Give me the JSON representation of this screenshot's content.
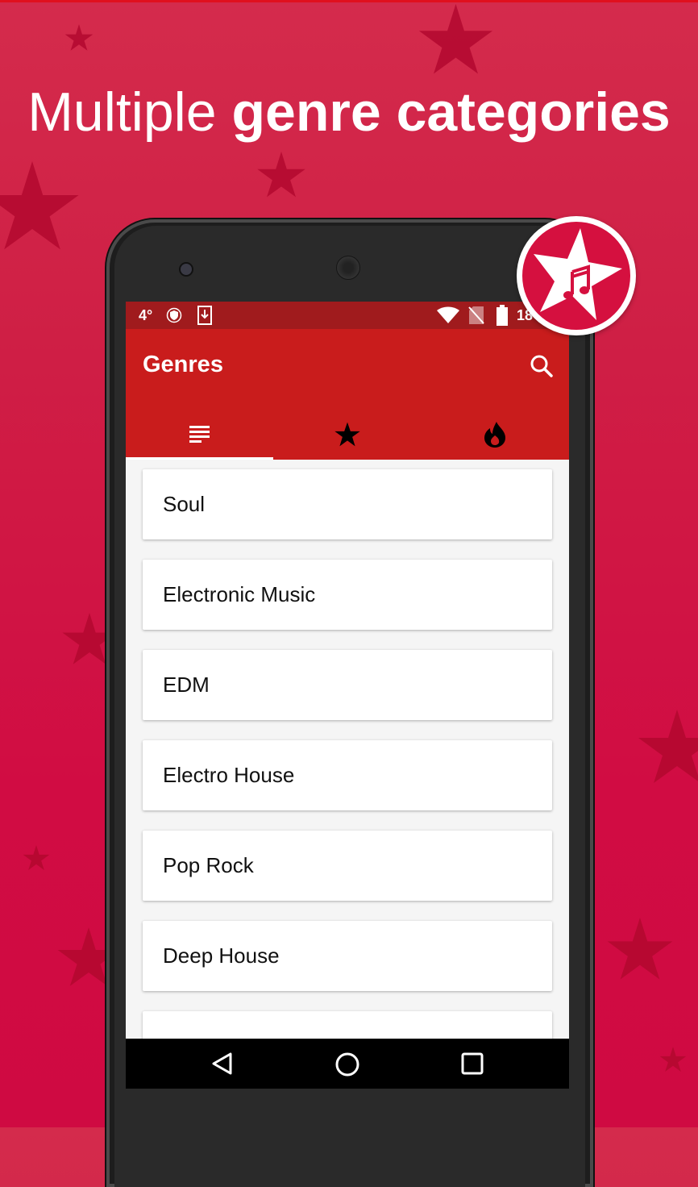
{
  "headline": {
    "light": "Multiple",
    "bold": "genre categories"
  },
  "status_bar": {
    "temperature": "4°",
    "time": "18"
  },
  "app_bar": {
    "title": "Genres"
  },
  "tabs": [
    {
      "name": "list",
      "icon": "list-icon",
      "active": true
    },
    {
      "name": "favorites",
      "icon": "star-icon",
      "active": false
    },
    {
      "name": "trending",
      "icon": "flame-icon",
      "active": false
    }
  ],
  "genres": [
    "Soul",
    "Electronic Music",
    "EDM",
    "Electro House",
    "Pop Rock",
    "Deep House",
    ""
  ],
  "colors": {
    "accent": "#c91c1c",
    "status_bar": "#a01b1d",
    "background": "#d10c43",
    "badge": "#d5103f"
  }
}
